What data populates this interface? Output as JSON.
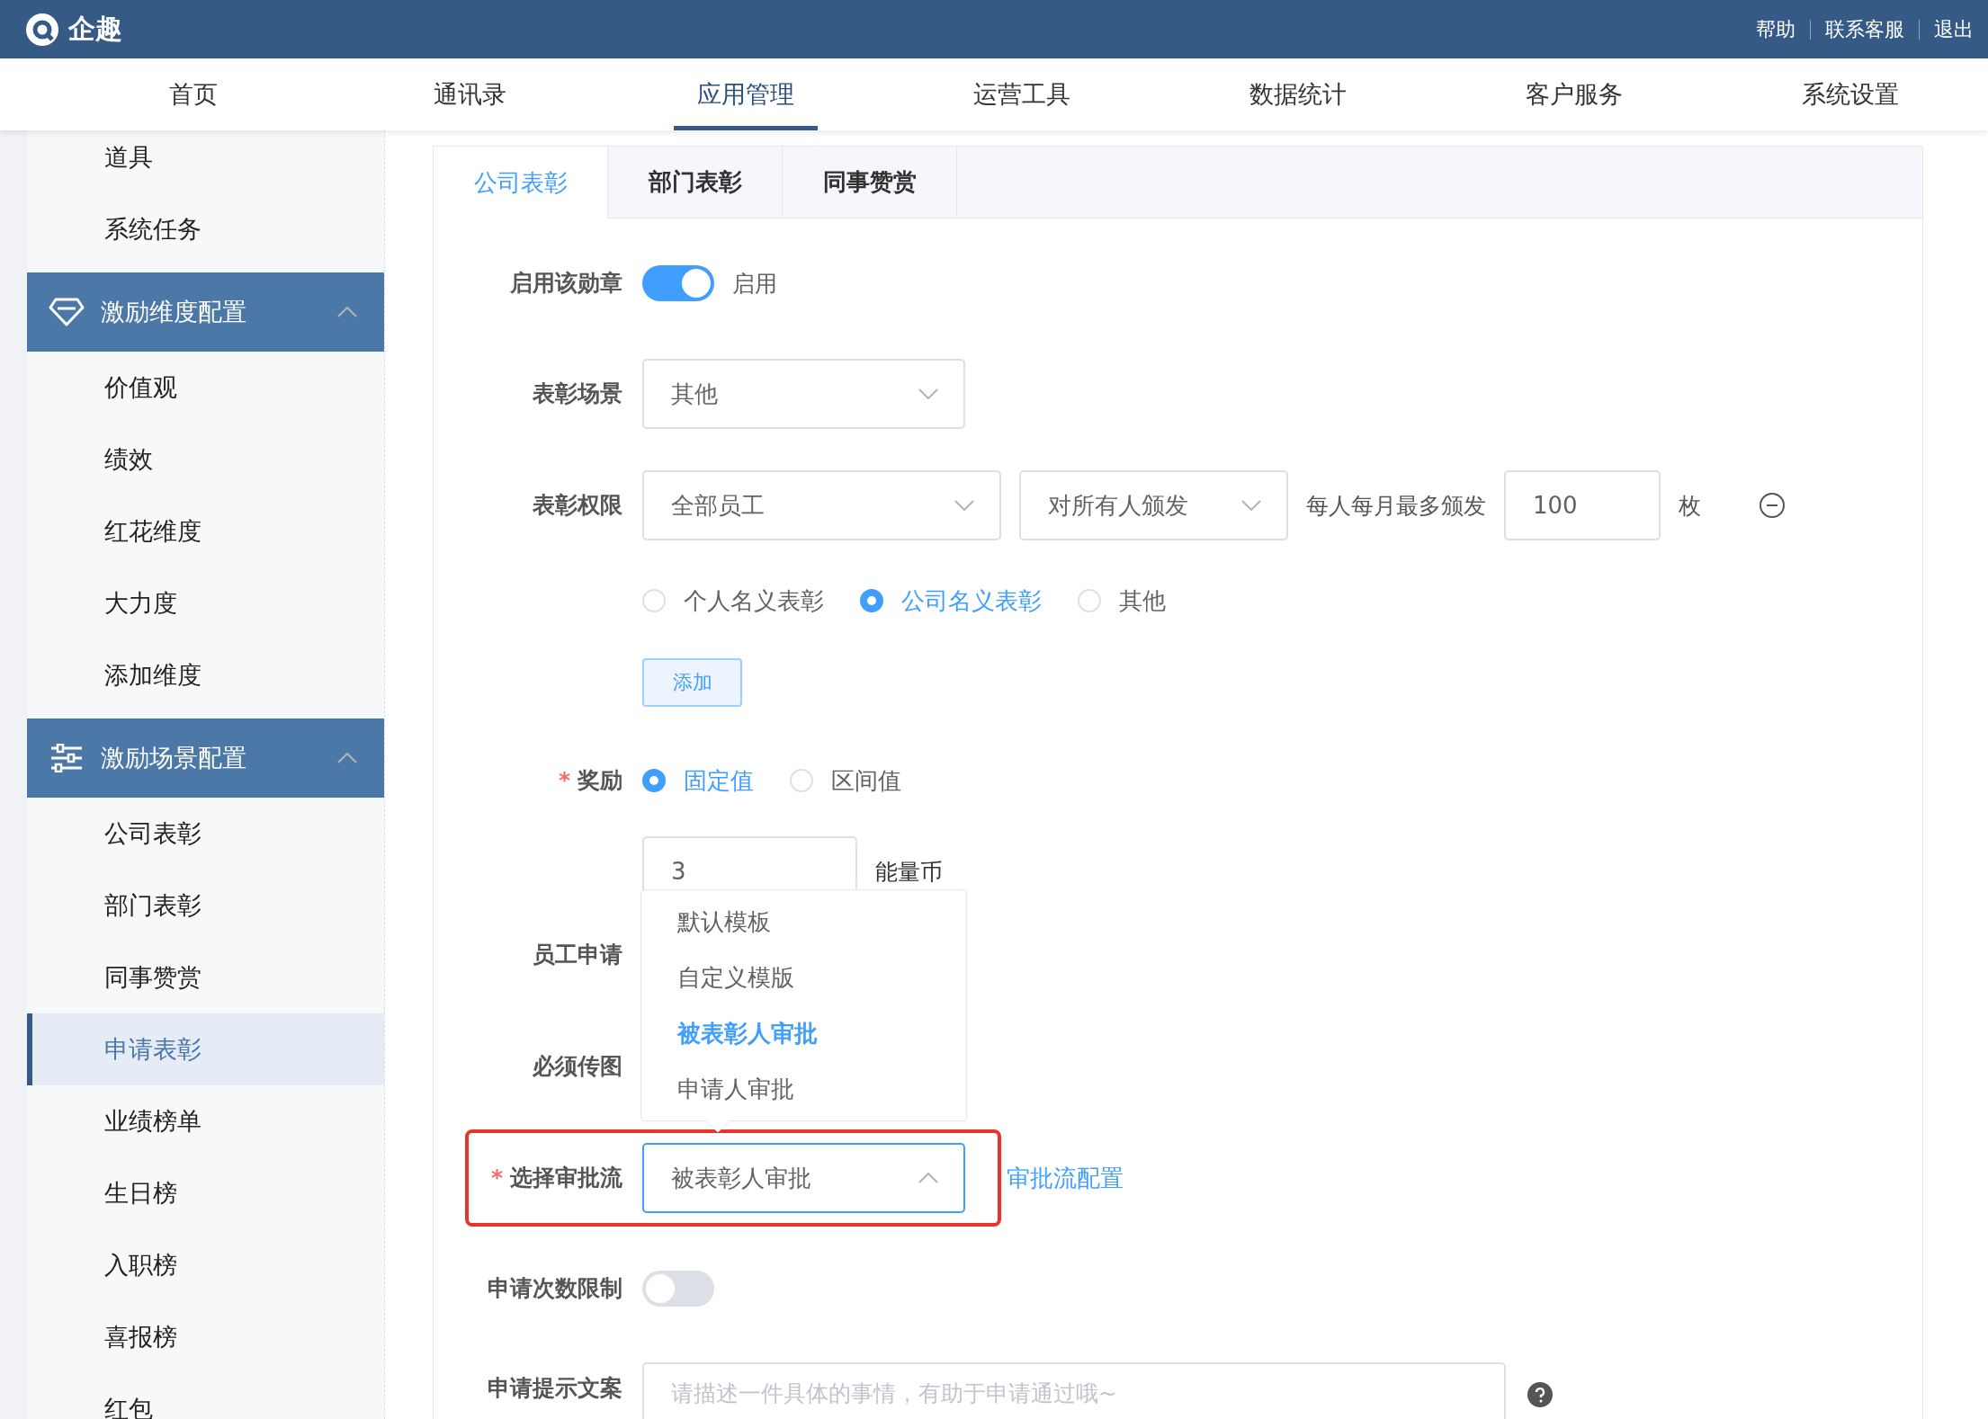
{
  "topbar": {
    "brand": "企趣",
    "links": [
      "帮助",
      "联系客服",
      "退出"
    ]
  },
  "nav": [
    {
      "label": "首页",
      "selected": false
    },
    {
      "label": "通讯录",
      "selected": false
    },
    {
      "label": "应用管理",
      "selected": true
    },
    {
      "label": "运营工具",
      "selected": false
    },
    {
      "label": "数据统计",
      "selected": false
    },
    {
      "label": "客户服务",
      "selected": false
    },
    {
      "label": "系统设置",
      "selected": false
    }
  ],
  "sidebar": {
    "items": [
      {
        "kind": "item",
        "label": "道具",
        "selected": false
      },
      {
        "kind": "item",
        "label": "系统任务",
        "selected": false
      },
      {
        "kind": "group",
        "label": "激励维度配置",
        "expanded": true,
        "children": [
          {
            "label": "价值观",
            "selected": false
          },
          {
            "label": "绩效",
            "selected": false
          },
          {
            "label": "红花维度",
            "selected": false
          },
          {
            "label": "大力度",
            "selected": false
          },
          {
            "label": "添加维度",
            "selected": false
          }
        ]
      },
      {
        "kind": "group",
        "label": "激励场景配置",
        "expanded": true,
        "children": [
          {
            "label": "公司表彰",
            "selected": false
          },
          {
            "label": "部门表彰",
            "selected": false
          },
          {
            "label": "同事赞赏",
            "selected": false
          },
          {
            "label": "申请表彰",
            "selected": true
          },
          {
            "label": "业绩榜单",
            "selected": false
          },
          {
            "label": "生日榜",
            "selected": false
          },
          {
            "label": "入职榜",
            "selected": false
          },
          {
            "label": "喜报榜",
            "selected": false
          },
          {
            "label": "红包",
            "selected": false
          }
        ]
      }
    ]
  },
  "tabs": [
    {
      "label": "公司表彰",
      "selected": true
    },
    {
      "label": "部门表彰",
      "selected": false
    },
    {
      "label": "同事赞赏",
      "selected": false
    }
  ],
  "form": [
    {
      "kind": "switch",
      "label": "启用该勋章",
      "on": true,
      "text": "启用"
    },
    {
      "kind": "select",
      "label": "表彰场景",
      "value": "其他"
    },
    {
      "kind": "permission",
      "label": "表彰权限",
      "selects": [
        "全部员工",
        "对所有人颁发"
      ],
      "limit_label": "每人每月最多颁发",
      "limit_value": "100",
      "unit": "枚"
    },
    {
      "kind": "radios",
      "options": [
        {
          "label": "个人名义表彰",
          "selected": false
        },
        {
          "label": "公司名义表彰",
          "selected": true
        },
        {
          "label": "其他",
          "selected": false
        }
      ]
    },
    {
      "kind": "button",
      "label": "添加"
    },
    {
      "kind": "radios",
      "label": "奖励",
      "required_mark": "*",
      "options": [
        {
          "label": "固定值",
          "selected": true
        },
        {
          "label": "区间值",
          "selected": false
        }
      ]
    },
    {
      "kind": "amount",
      "value": "3",
      "unit": "能量币"
    },
    {
      "kind": "label",
      "label": "员工申请"
    },
    {
      "kind": "label",
      "label": "必须传图"
    },
    {
      "kind": "select",
      "label": "选择审批流",
      "required_mark": "*",
      "value": "被表彰人审批",
      "expanded": true,
      "highlighted": true,
      "link": "审批流配置",
      "options": [
        {
          "label": "默认模板",
          "selected": false
        },
        {
          "label": "自定义模版",
          "selected": false
        },
        {
          "label": "被表彰人审批",
          "selected": true
        },
        {
          "label": "申请人审批",
          "selected": false
        }
      ]
    },
    {
      "kind": "switch",
      "label": "申请次数限制",
      "on": false
    },
    {
      "kind": "textarea",
      "label": "申请提示文案",
      "placeholder": "请描述一件具体的事情，有助于申请通过哦~"
    }
  ]
}
